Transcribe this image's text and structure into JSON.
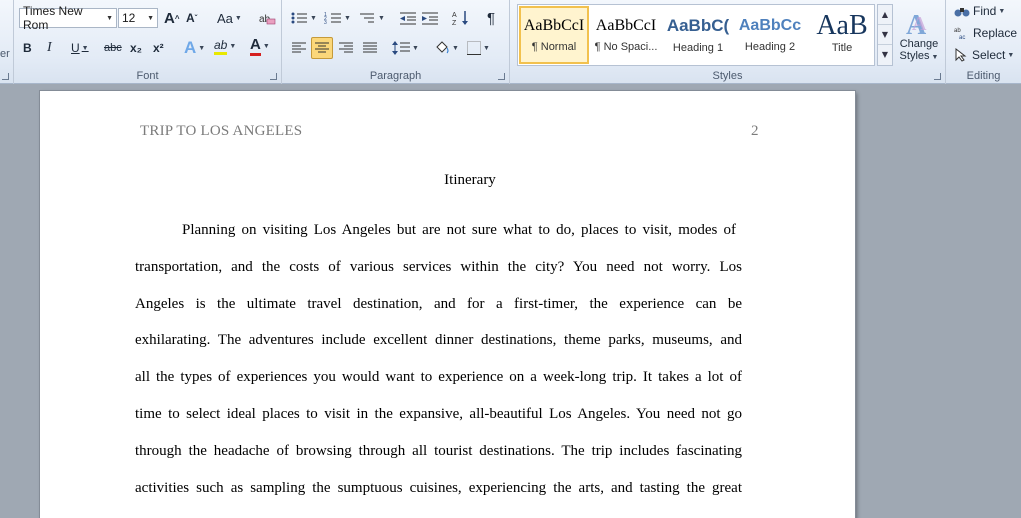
{
  "ribbon": {
    "font": {
      "label": "Font",
      "font_name": "Times New Rom",
      "font_size": "12",
      "grow_label": "A",
      "shrink_label": "A",
      "change_case_label": "Aa",
      "bold": "B",
      "italic": "I",
      "underline": "U",
      "strike": "abc",
      "subscript": "x₂",
      "superscript": "x²",
      "text_effects": "A",
      "highlight": "ab",
      "font_color": "A"
    },
    "paragraph": {
      "label": "Paragraph",
      "pilcrow": "¶"
    },
    "styles": {
      "label": "Styles",
      "items": [
        {
          "preview": "AaBbCcI",
          "name": "¶ Normal"
        },
        {
          "preview": "AaBbCcI",
          "name": "¶ No Spaci..."
        },
        {
          "preview": "AaBbC(",
          "name": "Heading 1"
        },
        {
          "preview": "AaBbCc",
          "name": "Heading 2"
        },
        {
          "preview": "AaB",
          "name": "Title"
        }
      ],
      "change_styles_line1": "Change",
      "change_styles_line2": "Styles"
    },
    "editing": {
      "label": "Editing",
      "find": "Find",
      "replace": "Replace",
      "select": "Select"
    },
    "clipboard_fragment": "er"
  },
  "colors": {
    "accent_selected": "#f2c14e",
    "heading_blue": "#365f91",
    "font_color_bar": "#d52020",
    "highlight_bar": "#e8e800"
  },
  "document": {
    "header": "TRIP TO LOS ANGELES",
    "page_number": "2",
    "title": "Itinerary",
    "lines": [
      "Planning on visiting Los Angeles but are not sure what to do, places to visit, modes of",
      "transportation, and the costs of various services within the city? You need not worry. Los",
      "Angeles is the ultimate travel destination, and for a first-timer, the experience can be",
      "exhilarating. The adventures include excellent dinner destinations, theme parks, museums, and",
      "all the types of experiences you would want to experience on a week-long trip. It takes a lot of",
      "time to select ideal places to visit in the expansive, all-beautiful Los Angeles. You need not go",
      "through the headache of browsing through all tourist destinations. The trip includes fascinating",
      "activities such as sampling the sumptuous cuisines, experiencing the arts, and tasting the great"
    ]
  }
}
